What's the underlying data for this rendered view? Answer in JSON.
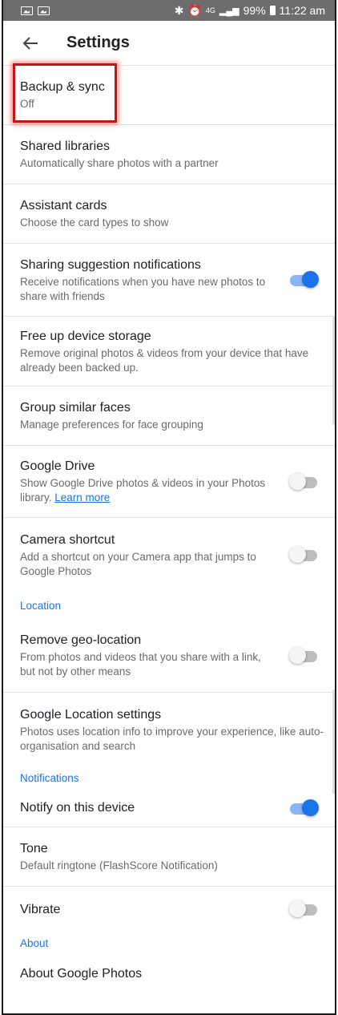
{
  "status_bar": {
    "network": "4G",
    "battery": "99%",
    "time": "11:22 am"
  },
  "app_bar": {
    "title": "Settings"
  },
  "settings": {
    "backup": {
      "title": "Backup & sync",
      "subtitle": "Off"
    },
    "shared": {
      "title": "Shared libraries",
      "subtitle": "Automatically share photos with a partner"
    },
    "assistant": {
      "title": "Assistant cards",
      "subtitle": "Choose the card types to show"
    },
    "sharing_suggestions": {
      "title": "Sharing suggestion notifications",
      "subtitle": "Receive notifications when you have new photos to share with friends",
      "enabled": true
    },
    "free_up": {
      "title": "Free up device storage",
      "subtitle": "Remove original photos & videos from your device that have already been backed up."
    },
    "group_faces": {
      "title": "Group similar faces",
      "subtitle": "Manage preferences for face grouping"
    },
    "google_drive": {
      "title": "Google Drive",
      "subtitle": "Show Google Drive photos & videos in your Photos library.",
      "link": "Learn more",
      "enabled": false
    },
    "camera_shortcut": {
      "title": "Camera shortcut",
      "subtitle": "Add a shortcut on your Camera app that jumps to Google Photos",
      "enabled": false
    },
    "location_header": "Location",
    "remove_geo": {
      "title": "Remove geo-location",
      "subtitle": "From photos and videos that you share with a link, but not by other means",
      "enabled": false
    },
    "location_settings": {
      "title": "Google Location settings",
      "subtitle": "Photos uses location info to improve your experience, like auto-organisation and search"
    },
    "notifications_header": "Notifications",
    "notify": {
      "title": "Notify on this device",
      "enabled": true
    },
    "tone": {
      "title": "Tone",
      "subtitle": "Default ringtone (FlashScore Notification)"
    },
    "vibrate": {
      "title": "Vibrate",
      "enabled": false
    },
    "about_header": "About",
    "about": {
      "title": "About Google Photos"
    }
  },
  "colors": {
    "accent": "#1a73e8",
    "highlight": "#c01818"
  }
}
